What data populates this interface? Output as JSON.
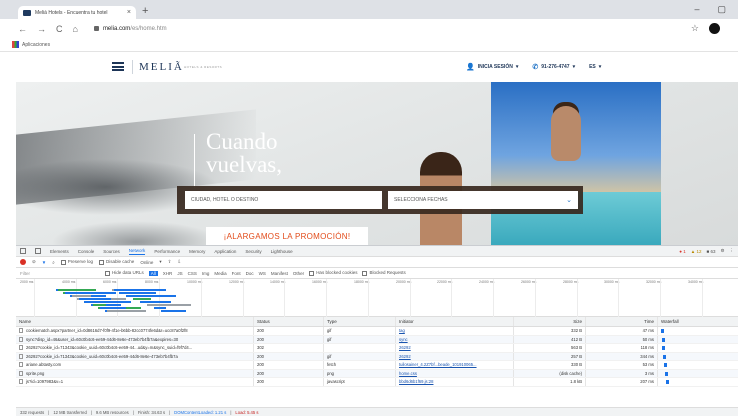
{
  "browser": {
    "tab_title": "Meliá Hotels - Encuentra tu hotel",
    "tab_close": "×",
    "new_tab": "+",
    "window_controls": [
      "–",
      "▢"
    ],
    "back": "←",
    "forward": "→",
    "reload": "C",
    "home": "⌂",
    "url_domain": "melia.com",
    "url_path": "/es/home.htm",
    "star": "☆",
    "bookmarks_label": "Aplicaciones"
  },
  "site": {
    "brand": "MELIÃ",
    "brand_sub": "HOTELS & RESORTS",
    "login": "INICIA SESIÓN",
    "phone": "91-276-4747",
    "language": "ES",
    "caret": "▾",
    "hero_title_line1": "Cuando",
    "hero_title_line2": "vuelvas,",
    "search_destination_placeholder": "CIUDAD, HOTEL O DESTINO",
    "search_dates": "SELECCIONA FECHAS",
    "search_chevron": "⌄",
    "promo": "¡ALARGAMOS LA PROMOCIÓN!"
  },
  "devtools": {
    "tabs": [
      "Elements",
      "Console",
      "Sources",
      "Network",
      "Performance",
      "Memory",
      "Application",
      "Security",
      "Lighthouse"
    ],
    "active_tab": "Network",
    "counts": {
      "errors": "1",
      "warnings": "12",
      "info": "63"
    },
    "toolbar": {
      "preserve_log": "Preserve log",
      "disable_cache": "Disable cache",
      "throttle": "Online"
    },
    "filter": {
      "placeholder": "Filter",
      "hide_data_urls": "Hide data URLs",
      "types": [
        "All",
        "XHR",
        "JS",
        "CSS",
        "Img",
        "Media",
        "Font",
        "Doc",
        "WS",
        "Manifest",
        "Other"
      ],
      "blocked_cookies": "Has blocked cookies",
      "blocked_requests": "Blocked Requests"
    },
    "timeline_ticks": [
      "2000 ms",
      "4000 ms",
      "6000 ms",
      "8000 ms",
      "10000 ms",
      "12000 ms",
      "14000 ms",
      "16000 ms",
      "18000 ms",
      "20000 ms",
      "22000 ms",
      "24000 ms",
      "26000 ms",
      "28000 ms",
      "30000 ms",
      "32000 ms",
      "34000 ms"
    ],
    "columns": {
      "name": "Name",
      "status": "Status",
      "type": "Type",
      "initiator": "Initiator",
      "size": "Size",
      "time": "Time",
      "waterfall": "Waterfall"
    },
    "rows": [
      {
        "name": "cookiematch.aspx?partner_id=0d8616d7-f0f9-4f1e-b6bb-82cc0774fe6d&r=ucc87a0f2f8",
        "status": "200",
        "type": "gif",
        "initiator": "tag",
        "size": "332 B",
        "time": "47 ms",
        "wf": 0.04
      },
      {
        "name": "sync?disp_id=46&user_id=60c0b4c6-ee59-44d6-8e6e-473eb7b4fb7a&expires=30",
        "status": "200",
        "type": "gif",
        "initiator": "sync",
        "size": "412 B",
        "time": "50 ms",
        "wf": 0.05
      },
      {
        "name": "26292?cookie_id=71343&cookie_uuid=60c0b4c6-ee59-44...ud&y=m&sync_suid=f9f7d4...",
        "status": "302",
        "type": "",
        "initiator": "26292",
        "size": "563 B",
        "time": "118 ms",
        "wf": 0.05
      },
      {
        "name": "26292?cookie_id=71343&cookie_uuid=60c0b4c6-ee59-44d6-8e6e-473eb7b4fb7a",
        "status": "200",
        "type": "gif",
        "initiator": "26292",
        "size": "257 B",
        "time": "344 ms",
        "wf": 0.06
      },
      {
        "name": "ariane.abtasty.com",
        "status": "200",
        "type": "fetch",
        "initiator": "tuilosainer_4.2Z7bf...beade_101910065...",
        "size": "330 B",
        "time": "53 ms",
        "wf": 0.07
      },
      {
        "name": "sprite.png",
        "status": "200",
        "type": "png",
        "initiator": "home.css",
        "size": "(disk cache)",
        "time": "3 ms",
        "wf": 0.09
      },
      {
        "name": "js?id=1097983&v=1",
        "status": "200",
        "type": "javascript",
        "initiator": "bbd6d6b1f69.js:28",
        "size": "1.8 kB",
        "time": "207 ms",
        "wf": 0.1
      }
    ],
    "status_bar": {
      "requests": "332 requests",
      "transferred": "12 MB transferred",
      "resources": "9.6 MB resources",
      "finish": "Finish: 34.63 s",
      "dcl": "DOMContentLoaded: 1.21 s",
      "load": "Load: 5.45 s"
    }
  }
}
